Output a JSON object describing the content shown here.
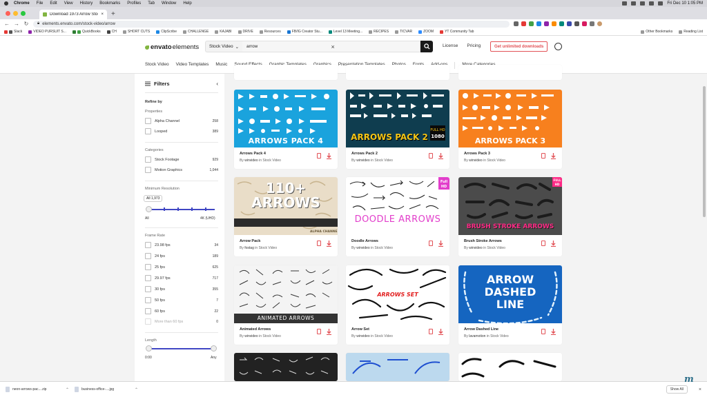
{
  "menubar": {
    "items": [
      "Chrome",
      "File",
      "Edit",
      "View",
      "History",
      "Bookmarks",
      "Profiles",
      "Tab",
      "Window",
      "Help"
    ],
    "clock": "Fri Dec 10  1:05 PM"
  },
  "browser": {
    "tab_title": "Download 1973 Arrow Stock V...",
    "url": "elements.envato.com/stock-video/arrow",
    "bookmarks": [
      "Slack",
      "VIDEO PURSUIT S...",
      "QuickBooks",
      "CH",
      "SHORT CUTS",
      "ClipScribe",
      "CHALLENGE",
      "KAJABI",
      "DRIVE",
      "Resources",
      "FB/IG Creator Stu...",
      "Level 13 Meeting...",
      "RECIPES",
      "TICVAR",
      "ZOOM",
      "YT Community Tab"
    ],
    "bookmarks_right": [
      "Other Bookmarks",
      "Reading List"
    ]
  },
  "header": {
    "logo_prefix": "envato",
    "logo_suffix": "elements",
    "search_scope": "Stock Video",
    "search_value": "arrow",
    "license": "License",
    "pricing": "Pricing",
    "cta": "Get unlimited downloads",
    "categories": [
      "Stock Video",
      "Video Templates",
      "Music",
      "Sound Effects",
      "Graphic Templates",
      "Graphics",
      "Presentation Templates",
      "Photos",
      "Fonts",
      "Add-ons"
    ],
    "more": "More Categories"
  },
  "sidebar": {
    "title": "Filters",
    "refine_by": "Refine by",
    "properties_label": "Properties",
    "properties": [
      {
        "label": "Alpha Channel",
        "count": "258"
      },
      {
        "label": "Looped",
        "count": "389"
      }
    ],
    "categories_label": "Categories",
    "categories": [
      {
        "label": "Stock Footage",
        "count": "929"
      },
      {
        "label": "Motion Graphics",
        "count": "1,044"
      }
    ],
    "resolution_label": "Minimum Resolution",
    "resolution_bubble": "All 1,973",
    "resolution_min": "All",
    "resolution_max": "4K (UHD)",
    "framerate_label": "Frame Rate",
    "framerates": [
      {
        "label": "23.98 fps",
        "count": "34"
      },
      {
        "label": "24 fps",
        "count": "189"
      },
      {
        "label": "25 fps",
        "count": "625"
      },
      {
        "label": "29.97 fps",
        "count": "717"
      },
      {
        "label": "30 fps",
        "count": "355"
      },
      {
        "label": "50 fps",
        "count": "7"
      },
      {
        "label": "60 fps",
        "count": "22"
      },
      {
        "label": "More than 60 fps",
        "count": "0"
      }
    ],
    "length_label": "Length",
    "length_min": "0:00",
    "length_max": "Any"
  },
  "cards": [
    {
      "title": "Arrows Pack 4",
      "by": "By",
      "author": "winvideo",
      "in": "in Stock Video",
      "overlay": "ARROWS PACK 4",
      "bg": "#1aa3dd",
      "fg": "#ffffff"
    },
    {
      "title": "Arrows Pack 2",
      "by": "By",
      "author": "winvideo",
      "in": "in Stock Video",
      "overlay": "ARROWS PACK 2",
      "bg": "#0f3d4f",
      "fg": "#f4c516"
    },
    {
      "title": "Arrows Pack 3",
      "by": "By",
      "author": "winvideo",
      "in": "in Stock Video",
      "overlay": "ARROWS PACK 3",
      "bg": "#f7801e",
      "fg": "#ffffff"
    },
    {
      "title": "Arrow Pack",
      "by": "By",
      "author": "fostag",
      "in": "in Stock Video",
      "overlay": "110+ ARROWS",
      "bg": "#e9ddc8",
      "fg": "#ffffff"
    },
    {
      "title": "Doodle Arrows",
      "by": "By",
      "author": "winvideo",
      "in": "in Stock Video",
      "overlay": "DOODLE ARROWS",
      "bg": "#ffffff",
      "fg": "#e23ecb"
    },
    {
      "title": "Brush Stroke Arrows",
      "by": "By",
      "author": "winvideo",
      "in": "in Stock Video",
      "overlay": "BRUSH STROKE ARROWS",
      "bg": "#4b4b4b",
      "fg": "#ff2a86"
    },
    {
      "title": "Animated Arrows",
      "by": "By",
      "author": "winvideo",
      "in": "in Stock Video",
      "overlay": "ANIMATED ARROWS",
      "bg": "#f4f4f4",
      "fg": "#ffffff"
    },
    {
      "title": "Arrow Set",
      "by": "By",
      "author": "winvideo",
      "in": "in Stock Video",
      "overlay": "ARROWS SET",
      "bg": "#ffffff",
      "fg": "#e21e1e"
    },
    {
      "title": "Arrow Dashed Line",
      "by": "By",
      "author": "lavamotion",
      "in": "in Stock Video",
      "overlay": "ARROW DASHED LINE",
      "bg": "#1565c0",
      "fg": "#ffffff"
    }
  ],
  "downloads": [
    {
      "name": "neon-arrows-pac....zip"
    },
    {
      "name": "business-office-....jpg"
    }
  ],
  "show_all": "Show All"
}
